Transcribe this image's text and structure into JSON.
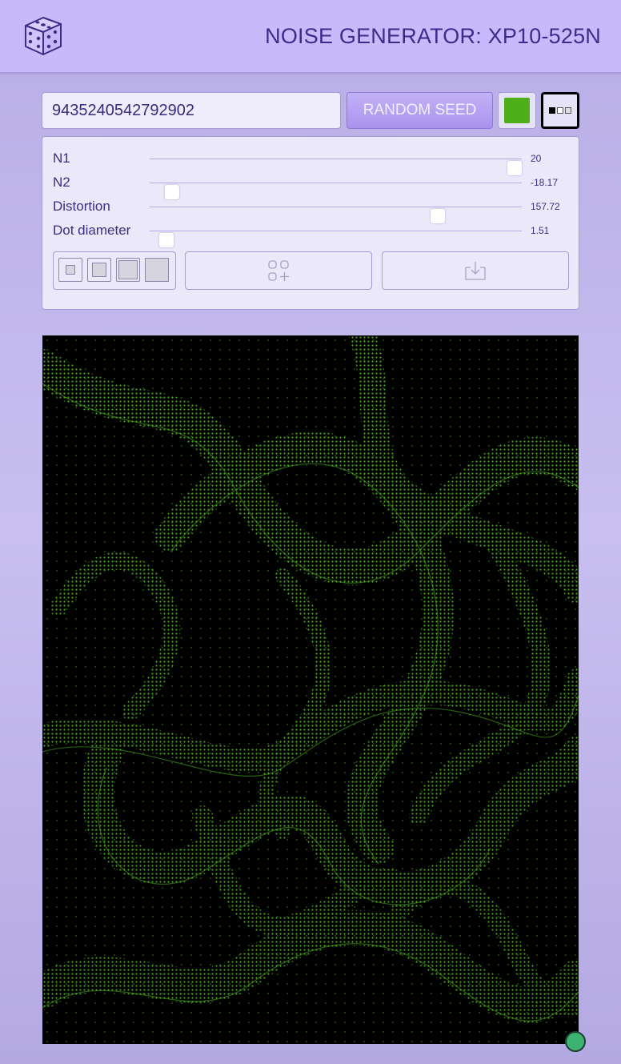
{
  "header": {
    "title": "NOISE GENERATOR: XP10-525N",
    "logo_icon": "dice-icon"
  },
  "controls": {
    "seed_value": "9435240542792902",
    "random_seed_label": "RANDOM SEED",
    "dot_color": "#4caf1a",
    "pattern_icon": "dot-pattern-icon"
  },
  "sliders": [
    {
      "label": "N1",
      "value": "20",
      "fraction": 0.98
    },
    {
      "label": "N2",
      "value": "-18.17",
      "fraction": 0.06
    },
    {
      "label": "Distortion",
      "value": "157.72",
      "fraction": 0.775
    },
    {
      "label": "Dot diameter",
      "value": "1.51",
      "fraction": 0.045
    }
  ],
  "actions": {
    "size_options": [
      "size-small",
      "size-medium",
      "size-large",
      "size-xlarge"
    ],
    "add_icon": "grid-add-icon",
    "download_icon": "download-icon"
  },
  "canvas": {
    "background": "#000000",
    "dot_color": "#4caf1a"
  },
  "status": {
    "color": "#3cb371"
  }
}
